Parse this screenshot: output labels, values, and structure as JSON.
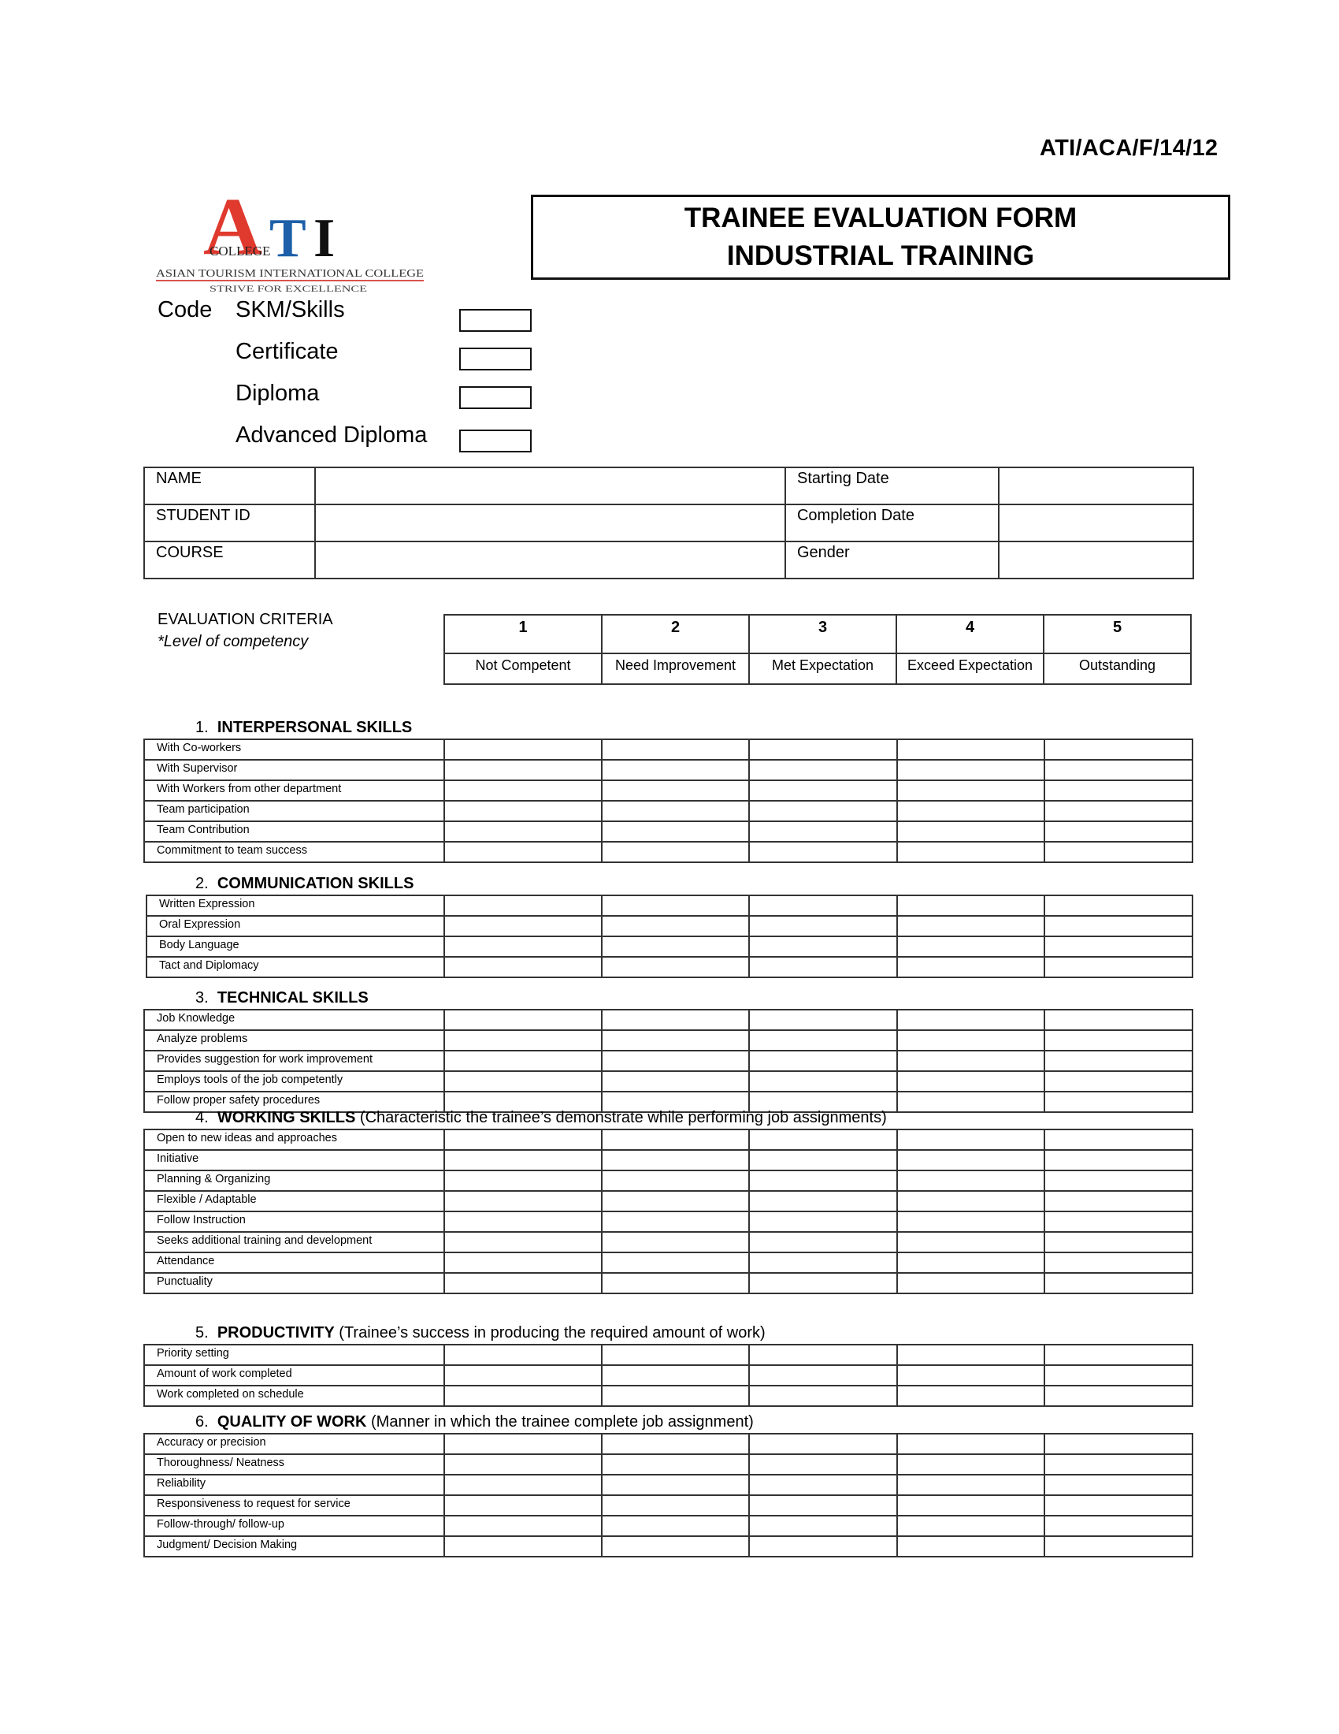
{
  "document_code": "ATI/ACA/F/14/12",
  "logo": {
    "letters": [
      "A",
      "T",
      "I"
    ],
    "letter_colors": [
      "#e0392e",
      "#1d5fa8",
      "#111111"
    ],
    "college_word": "COLLEGE",
    "full_name": "ASIAN TOURISM INTERNATIONAL COLLEGE",
    "tagline": "STRIVE FOR EXCELLENCE",
    "accent_line_color": "#d9534f"
  },
  "title": "TRAINEE EVALUATION FORM INDUSTRIAL TRAINING",
  "code_section": {
    "label": "Code",
    "programs": [
      "SKM/Skills",
      "Certificate",
      "Diploma",
      "Advanced Diploma"
    ]
  },
  "student_info": {
    "rows": [
      {
        "left_label": "NAME",
        "left_value": "",
        "right_label": "Starting Date",
        "right_value": ""
      },
      {
        "left_label": "STUDENT ID",
        "left_value": "",
        "right_label": "Completion Date",
        "right_value": ""
      },
      {
        "left_label": "COURSE",
        "left_value": "",
        "right_label": "Gender",
        "right_value": ""
      }
    ]
  },
  "evaluation_criteria": {
    "heading": "EVALUATION CRITERIA",
    "subheading": "*Level of competency",
    "levels": [
      {
        "score": "1",
        "label": "Not Competent"
      },
      {
        "score": "2",
        "label": "Need Improvement"
      },
      {
        "score": "3",
        "label": "Met Expectation"
      },
      {
        "score": "4",
        "label": "Exceed Expectation"
      },
      {
        "score": "5",
        "label": "Outstanding"
      }
    ]
  },
  "sections": [
    {
      "number": "1.",
      "title": "INTERPERSONAL SKILLS",
      "note": "",
      "items": [
        "With Co-workers",
        "With Supervisor",
        "With Workers from other department",
        "Team participation",
        "Team Contribution",
        "Commitment to team success"
      ]
    },
    {
      "number": "2.",
      "title": "COMMUNICATION SKILLS",
      "note": "",
      "items": [
        "Written Expression",
        "Oral Expression",
        "Body Language",
        "Tact and Diplomacy"
      ]
    },
    {
      "number": "3.",
      "title": "TECHNICAL SKILLS",
      "note": "",
      "items": [
        "Job Knowledge",
        "Analyze problems",
        "Provides suggestion for work improvement",
        "Employs tools of the job competently",
        "Follow proper safety procedures"
      ]
    },
    {
      "number": "4.",
      "title": "WORKING SKILLS",
      "note": "(Characteristic the trainee’s demonstrate while performing job assignments)",
      "items": [
        "Open to new ideas and approaches",
        "Initiative",
        "Planning & Organizing",
        "Flexible / Adaptable",
        "Follow Instruction",
        "Seeks additional training and development",
        "Attendance",
        "Punctuality"
      ]
    },
    {
      "number": "5.",
      "title": "PRODUCTIVITY",
      "note": "(Trainee’s success in producing the required amount of work)",
      "items": [
        "Priority setting",
        "Amount of work completed",
        "Work completed on schedule"
      ]
    },
    {
      "number": "6.",
      "title": "QUALITY OF WORK",
      "note": "(Manner in which the trainee complete job assignment)",
      "items": [
        "Accuracy or precision",
        "Thoroughness/ Neatness",
        "Reliability",
        "Responsiveness to request for service",
        "Follow-through/ follow-up",
        "Judgment/ Decision Making"
      ]
    }
  ]
}
